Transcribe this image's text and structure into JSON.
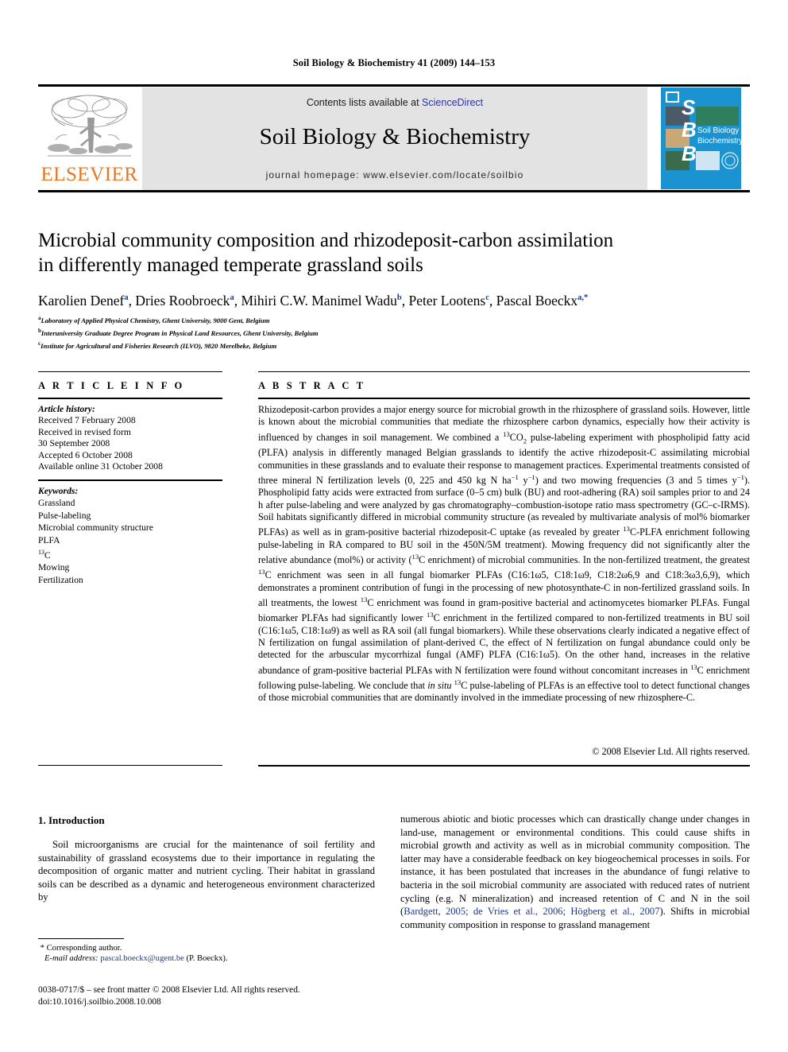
{
  "running_head": "Soil Biology & Biochemistry 41 (2009) 144–153",
  "masthead": {
    "contents_prefix": "Contents lists available at ",
    "sciencedirect": "ScienceDirect",
    "journal_title": "Soil Biology & Biochemistry",
    "homepage": "journal homepage: www.elsevier.com/locate/soilbio",
    "publisher_wordmark": "ELSEVIER",
    "publisher_logo_icon": "elsevier-tree-icon",
    "cover_letters": [
      "S",
      "B",
      "B"
    ],
    "cover_title_line1": "Soil Biology &",
    "cover_title_line2": "Biochemistry",
    "link_color": "#2b32a8",
    "brand_orange": "#E87722",
    "cover_blue": "#1b93d1",
    "band_gray": "#e3e3e3"
  },
  "article": {
    "title_line1": "Microbial community composition and rhizodeposit-carbon assimilation",
    "title_line2": "in differently managed temperate grassland soils",
    "authors": [
      {
        "name": "Karolien Denef",
        "marks": "a"
      },
      {
        "name": "Dries Roobroeck",
        "marks": "a"
      },
      {
        "name": "Mihiri C.W. Manimel Wadu",
        "marks": "b"
      },
      {
        "name": "Peter Lootens",
        "marks": "c"
      },
      {
        "name": "Pascal Boeckx",
        "marks": "a,*"
      }
    ],
    "affiliations": [
      {
        "mark": "a",
        "text": "Laboratory of Applied Physical Chemistry, Ghent University, 9000 Gent, Belgium"
      },
      {
        "mark": "b",
        "text": "Interuniversity Graduate Degree Program in Physical Land Resources, Ghent University, Belgium"
      },
      {
        "mark": "c",
        "text": "Institute for Agricultural and Fisheries Research (ILVO), 9820 Merelbeke, Belgium"
      }
    ]
  },
  "article_info": {
    "label": "A R T I C L E  I N F O",
    "history_heading": "Article history:",
    "history": [
      "Received 7 February 2008",
      "Received in revised form",
      "30 September 2008",
      "Accepted 6 October 2008",
      "Available online 31 October 2008"
    ],
    "keywords_heading": "Keywords:",
    "keywords": [
      "Grassland",
      "Pulse-labeling",
      "Microbial community structure",
      "PLFA",
      "13C",
      "Mowing",
      "Fertilization"
    ]
  },
  "abstract": {
    "label": "A B S T R A C T",
    "text": "Rhizodeposit-carbon provides a major energy source for microbial growth in the rhizosphere of grassland soils. However, little is known about the microbial communities that mediate the rhizosphere carbon dynamics, especially how their activity is influenced by changes in soil management. We combined a 13CO2 pulse-labeling experiment with phospholipid fatty acid (PLFA) analysis in differently managed Belgian grasslands to identify the active rhizodeposit-C assimilating microbial communities in these grasslands and to evaluate their response to management practices. Experimental treatments consisted of three mineral N fertilization levels (0, 225 and 450 kg N ha-1 y-1) and two mowing frequencies (3 and 5 times y-1). Phospholipid fatty acids were extracted from surface (0–5 cm) bulk (BU) and root-adhering (RA) soil samples prior to and 24 h after pulse-labeling and were analyzed by gas chromatography–combustion-isotope ratio mass spectrometry (GC–c-IRMS). Soil habitats significantly differed in microbial community structure (as revealed by multivariate analysis of mol% biomarker PLFAs) as well as in gram-positive bacterial rhizodeposit-C uptake (as revealed by greater 13C-PLFA enrichment following pulse-labeling in RA compared to BU soil in the 450N/5M treatment). Mowing frequency did not significantly alter the relative abundance (mol%) or activity (13C enrichment) of microbial communities. In the non-fertilized treatment, the greatest 13C enrichment was seen in all fungal biomarker PLFAs (C16:1ω5, C18:1ω9, C18:2ω6,9 and C18:3ω3,6,9), which demonstrates a prominent contribution of fungi in the processing of new photosynthate-C in non-fertilized grassland soils. In all treatments, the lowest 13C enrichment was found in gram-positive bacterial and actinomycetes biomarker PLFAs. Fungal biomarker PLFAs had significantly lower 13C enrichment in the fertilized compared to non-fertilized treatments in BU soil (C16:1ω5, C18:1ω9) as well as RA soil (all fungal biomarkers). While these observations clearly indicated a negative effect of N fertilization on fungal assimilation of plant-derived C, the effect of N fertilization on fungal abundance could only be detected for the arbuscular mycorrhizal fungal (AMF) PLFA (C16:1ω5). On the other hand, increases in the relative abundance of gram-positive bacterial PLFAs with N fertilization were found without concomitant increases in 13C enrichment following pulse-labeling. We conclude that in situ 13C pulse-labeling of PLFAs is an effective tool to detect functional changes of those microbial communities that are dominantly involved in the immediate processing of new rhizosphere-C.",
    "copyright": "© 2008 Elsevier Ltd. All rights reserved."
  },
  "introduction": {
    "heading": "1. Introduction",
    "left_paragraph": "Soil microorganisms are crucial for the maintenance of soil fertility and sustainability of grassland ecosystems due to their importance in regulating the decomposition of organic matter and nutrient cycling. Their habitat in grassland soils can be described as a dynamic and heterogeneous environment characterized by",
    "right_paragraph_part1": "numerous abiotic and biotic processes which can drastically change under changes in land-use, management or environmental conditions. This could cause shifts in microbial growth and activity as well as in microbial community composition. The latter may have a considerable feedback on key biogeochemical processes in soils. For instance, it has been postulated that increases in the abundance of fungi relative to bacteria in the soil microbial community are associated with reduced rates of nutrient cycling (e.g. N mineralization) and increased retention of C and N in the soil (",
    "right_citation": "Bardgett, 2005; de Vries et al., 2006; Högberg et al., 2007",
    "right_paragraph_part2": "). Shifts in microbial community composition in response to grassland management"
  },
  "footer": {
    "corresponding_marker": "*",
    "corresponding_label": "Corresponding author.",
    "email_label": "E-mail address:",
    "email": "pascal.boeckx@ugent.be",
    "email_owner": "(P. Boeckx).",
    "issn_line": "0038-0717/$ – see front matter © 2008 Elsevier Ltd. All rights reserved.",
    "doi_line": "doi:10.1016/j.soilbio.2008.10.008"
  }
}
